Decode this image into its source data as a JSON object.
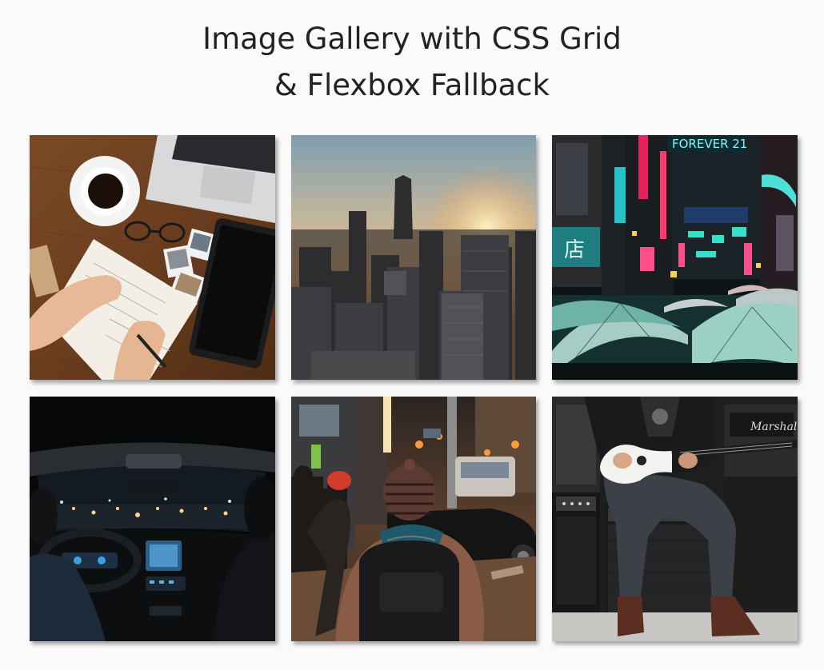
{
  "page": {
    "title_line1": "Image Gallery with CSS Grid",
    "title_line2": "& Flexbox Fallback"
  },
  "gallery": {
    "images": [
      {
        "name": "workspace-desk-photo"
      },
      {
        "name": "city-sunset-skyline-photo"
      },
      {
        "name": "neon-street-umbrellas-photo"
      },
      {
        "name": "night-car-interior-photo"
      },
      {
        "name": "city-street-walker-photo"
      },
      {
        "name": "guitarist-with-amps-photo"
      }
    ],
    "signs": {
      "forever21": "FOREVER 21",
      "shop": "店",
      "marshall": "Marshall"
    }
  },
  "colors": {
    "background": "#fafafa",
    "title": "#222222"
  }
}
